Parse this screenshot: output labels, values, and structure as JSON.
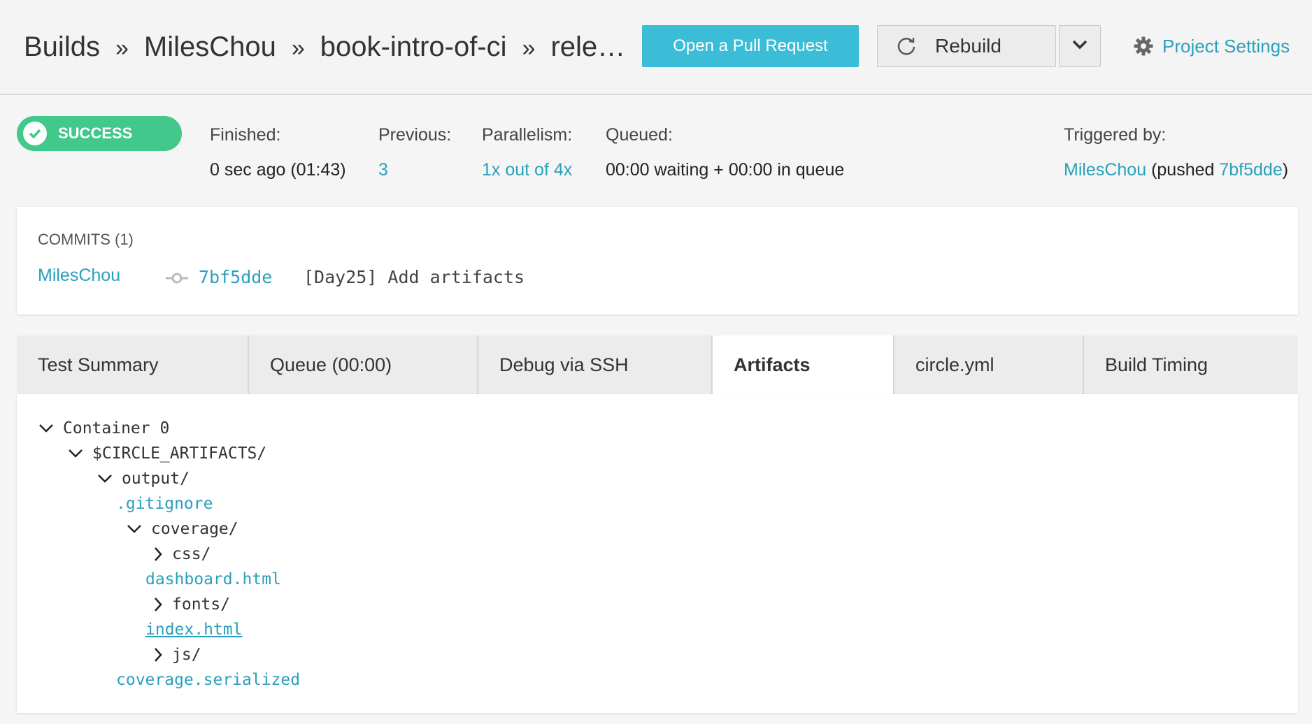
{
  "header": {
    "breadcrumb": [
      "Builds",
      "MilesChou",
      "book-intro-of-ci",
      "rele…"
    ],
    "breadcrumb_separator": "»",
    "pull_request_label": "Open a Pull Request",
    "rebuild_label": "Rebuild",
    "project_settings_label": "Project Settings"
  },
  "status": {
    "badge": "SUCCESS",
    "finished_label": "Finished:",
    "finished_value": "0 sec ago (01:43)",
    "previous_label": "Previous:",
    "previous_value": "3",
    "parallelism_label": "Parallelism:",
    "parallelism_value": "1x out of 4x",
    "queued_label": "Queued:",
    "queued_value": "00:00 waiting + 00:00 in queue",
    "triggered_label": "Triggered by:",
    "triggered_user": "MilesChou",
    "triggered_pushed_prefix": "(pushed ",
    "triggered_sha": "7bf5dde",
    "triggered_suffix": ")"
  },
  "commits": {
    "title": "COMMITS (1)",
    "author": "MilesChou",
    "sha": "7bf5dde",
    "message": "[Day25] Add artifacts"
  },
  "tabs": [
    {
      "label": "Test Summary"
    },
    {
      "label": "Queue (00:00)"
    },
    {
      "label": "Debug via SSH"
    },
    {
      "label": "Artifacts",
      "active": true
    },
    {
      "label": "circle.yml"
    },
    {
      "label": "Build Timing"
    }
  ],
  "artifacts": {
    "tree": [
      {
        "label": "Container 0",
        "type": "folder",
        "state": "expanded"
      },
      {
        "label": "$CIRCLE_ARTIFACTS/",
        "type": "folder",
        "state": "expanded"
      },
      {
        "label": "output/",
        "type": "folder",
        "state": "expanded"
      },
      {
        "label": ".gitignore",
        "type": "file"
      },
      {
        "label": "coverage/",
        "type": "folder",
        "state": "expanded"
      },
      {
        "label": "css/",
        "type": "folder",
        "state": "collapsed"
      },
      {
        "label": "dashboard.html",
        "type": "file"
      },
      {
        "label": "fonts/",
        "type": "folder",
        "state": "collapsed"
      },
      {
        "label": "index.html",
        "type": "file",
        "underlined": true
      },
      {
        "label": "js/",
        "type": "folder",
        "state": "collapsed"
      },
      {
        "label": "coverage.serialized",
        "type": "file"
      }
    ]
  },
  "colors": {
    "accent": "#2aa0bc",
    "button_primary": "#3bbcd7",
    "success": "#42c88a"
  }
}
